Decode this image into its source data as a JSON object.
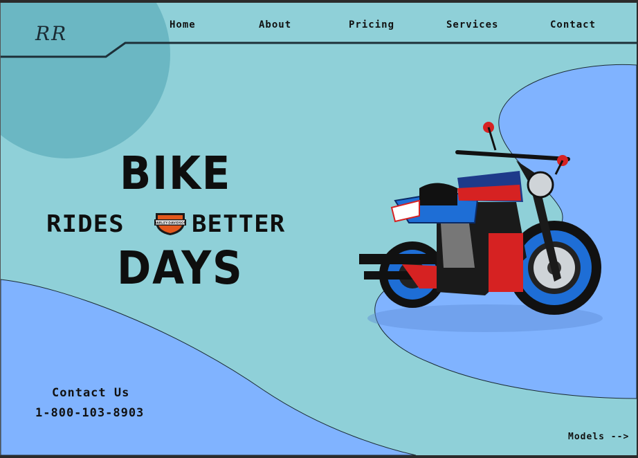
{
  "brand": {
    "logo_text": "RR"
  },
  "nav": {
    "items": [
      {
        "label": "Home"
      },
      {
        "label": "About"
      },
      {
        "label": "Pricing"
      },
      {
        "label": "Services"
      },
      {
        "label": "Contact"
      }
    ]
  },
  "hero": {
    "line1": "BIKE",
    "line2_left": "RIDES",
    "line2_right": "BETTER",
    "line3": "DAYS",
    "badge_text": "HARLEY-DAVIDSON"
  },
  "contact": {
    "title": "Contact Us",
    "phone": "1-800-103-8903"
  },
  "footer": {
    "models_link": "Models -->"
  },
  "colors": {
    "background": "#8fd0d8",
    "circle": "#6bb7c3",
    "blue_shape": "#80b3ff",
    "text": "#0e0e0e",
    "hd_orange": "#e2581c"
  }
}
